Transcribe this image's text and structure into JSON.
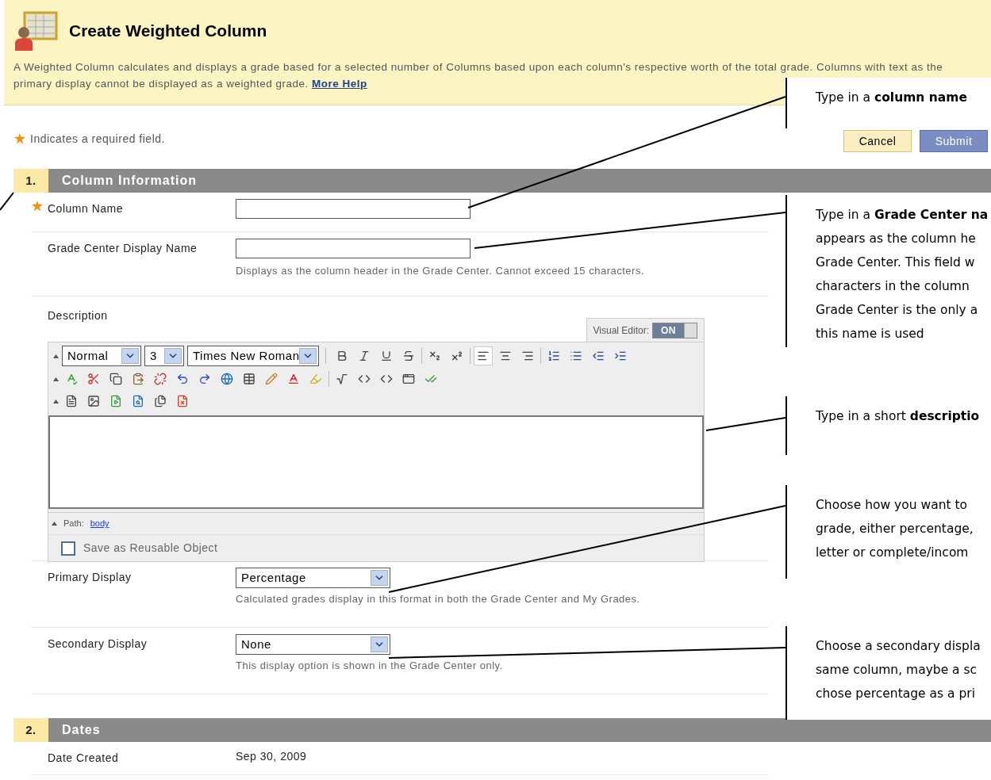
{
  "header": {
    "title": "Create Weighted Column",
    "description": "A Weighted Column calculates and displays a grade based for a selected number of Columns based upon each column's respective worth of the total grade. Columns with text as the primary display cannot be displayed as a weighted grade.",
    "link": "More Help"
  },
  "required_note": "Indicates a required field.",
  "buttons": [
    {
      "label": "Cancel",
      "kind": "secondary"
    },
    {
      "label": "Submit",
      "kind": "primary"
    }
  ],
  "sections": [
    {
      "number": "1.",
      "title": "Column Information",
      "fields": [
        {
          "kind": "text",
          "label": "Column Name",
          "required": true
        },
        {
          "kind": "text",
          "label": "Grade Center Display Name",
          "required": false,
          "hint": "Displays as the column header in the Grade Center. Cannot exceed 15 characters."
        },
        {
          "kind": "editor",
          "label": "Description",
          "required": false
        },
        {
          "kind": "select",
          "label": "Primary Display",
          "required": false,
          "value": "Percentage",
          "hint": "Calculated grades display in this format in both the Grade Center and My Grades."
        },
        {
          "kind": "select",
          "label": "Secondary Display",
          "required": false,
          "value": "None",
          "hint": "This display option is shown in the Grade Center only."
        }
      ]
    },
    {
      "number": "2.",
      "title": "Dates",
      "fields": [
        {
          "kind": "static",
          "label": "Date Created",
          "required": false,
          "value": "Sep 30, 2009"
        }
      ]
    }
  ],
  "editor": {
    "visual_editor_label": "Visual Editor:",
    "visual_editor_on": true,
    "toggle_text": "ON",
    "format": "Normal",
    "size": "3",
    "font": "Times New Roman",
    "alignments": [
      {
        "selected": true
      },
      {
        "selected": false
      },
      {
        "selected": false
      }
    ],
    "path_label": "Path:",
    "path_link": "body",
    "reusable_label": "Save as Reusable Object",
    "reusable_checked": false
  },
  "callouts": [
    {
      "lines": [
        "Type in a **column name**"
      ]
    },
    {
      "lines": [
        "Type in a **Grade Center na**",
        "appears as the column he",
        "Grade Center. This field w",
        "characters in the column",
        "Grade Center is the only a",
        "this name is used"
      ]
    },
    {
      "lines": [
        "Type in a short **descriptio**"
      ]
    },
    {
      "lines": [
        "Choose how you want to",
        "grade, either percentage,",
        "letter or complete/incom"
      ]
    },
    {
      "lines": [
        "Choose a secondary displa",
        "same column, maybe a sc",
        "chose percentage as a pri"
      ]
    }
  ]
}
